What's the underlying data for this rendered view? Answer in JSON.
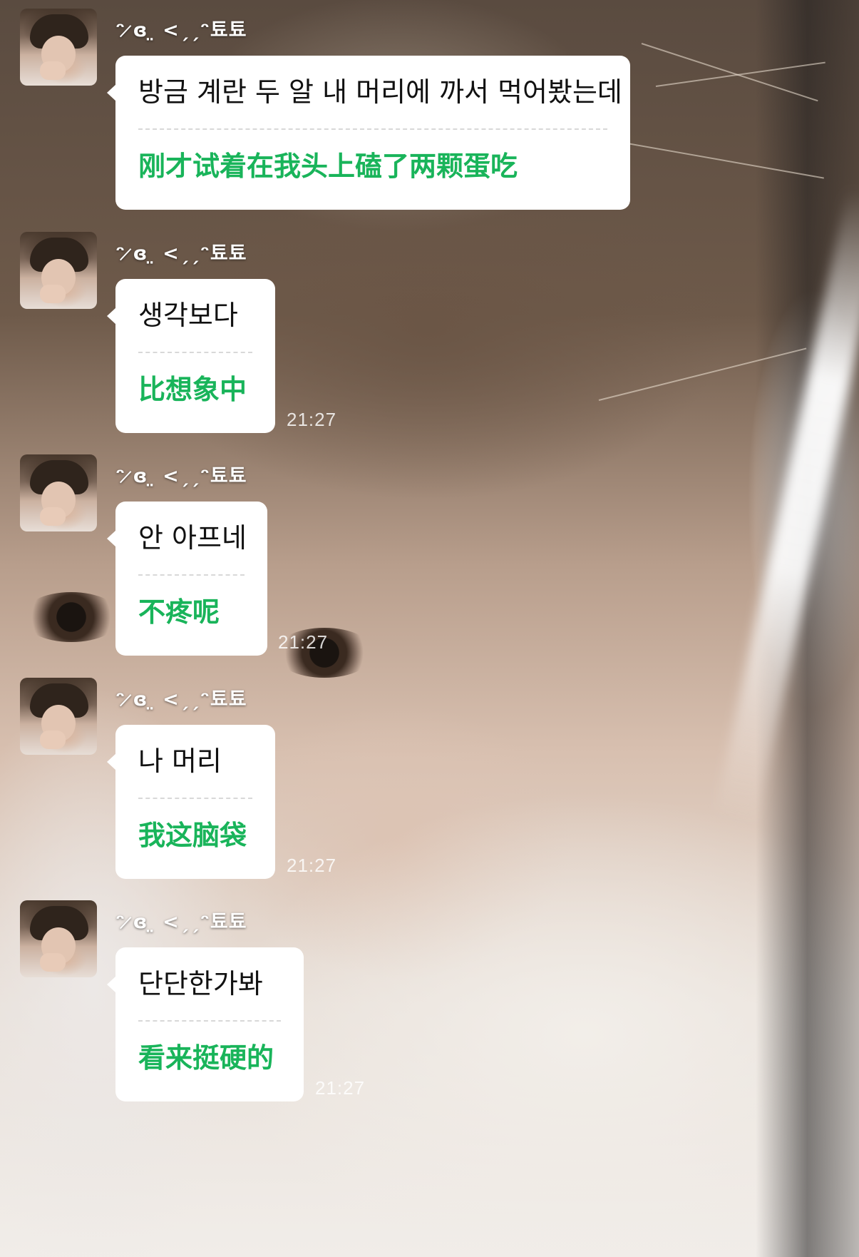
{
  "sender": {
    "nickname": "ᵔ ̷ɞ ̤ <ˏˏᵔ툐툐"
  },
  "messages": [
    {
      "korean": "방금 계란 두 알 내 머리에 까서 먹어봤는데",
      "chinese": "刚才试着在我头上磕了两颗蛋吃",
      "time": ""
    },
    {
      "korean": "생각보다",
      "chinese": "比想象中",
      "time": "21:27"
    },
    {
      "korean": "안 아프네",
      "chinese": "不疼呢",
      "time": "21:27"
    },
    {
      "korean": "나 머리",
      "chinese": "我这脑袋",
      "time": "21:27"
    },
    {
      "korean": "단단한가봐",
      "chinese": "看来挺硬的",
      "time": "21:27"
    }
  ]
}
